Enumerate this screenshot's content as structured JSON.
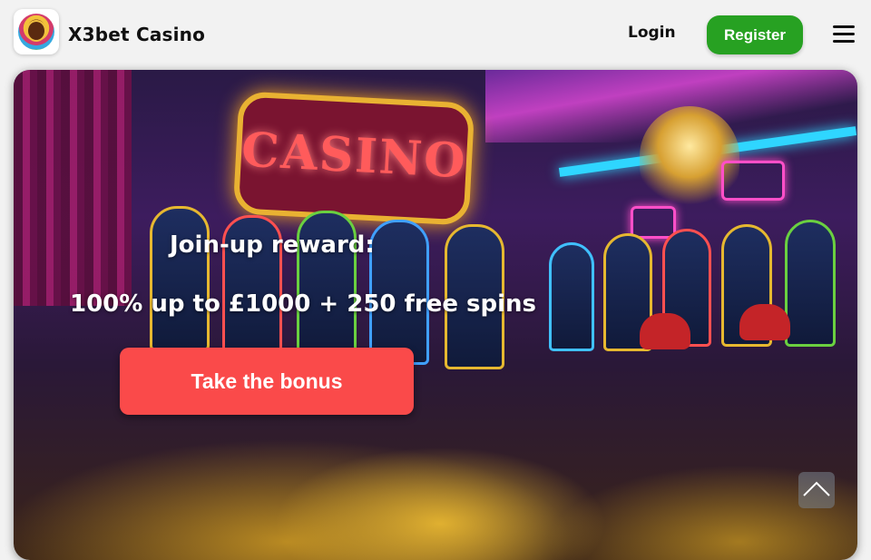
{
  "header": {
    "brand": "X3bet Casino",
    "login_label": "Login",
    "register_label": "Register",
    "register_color": "#27a122",
    "logo_icon": "casino-logo-icon",
    "menu_icon": "hamburger-menu-icon"
  },
  "hero": {
    "sign_text": "CASINO",
    "reward_title": "Join-up reward:",
    "reward_offer": "100% up to £1000 + 250 free spins",
    "bonus_button_label": "Take the bonus",
    "bonus_button_color": "#fa4a4a"
  },
  "scroll_top": {
    "icon": "chevron-up-icon"
  }
}
